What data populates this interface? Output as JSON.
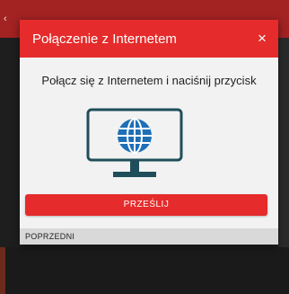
{
  "app": {
    "back_icon": "chevron-left-icon",
    "topbar_color": "#a32222"
  },
  "dialog": {
    "title": "Połączenie z Internetem",
    "close_glyph": "×",
    "close_icon": "close-icon",
    "message": "Połącz się z Internetem i naciśnij przycisk",
    "illustration_icon": "monitor-globe-icon",
    "submit_label": "PRZEŚLIJ",
    "previous_label": "POPRZEDNI",
    "accent_color": "#e52b2b",
    "illustration_color": "#1f4e5a"
  }
}
